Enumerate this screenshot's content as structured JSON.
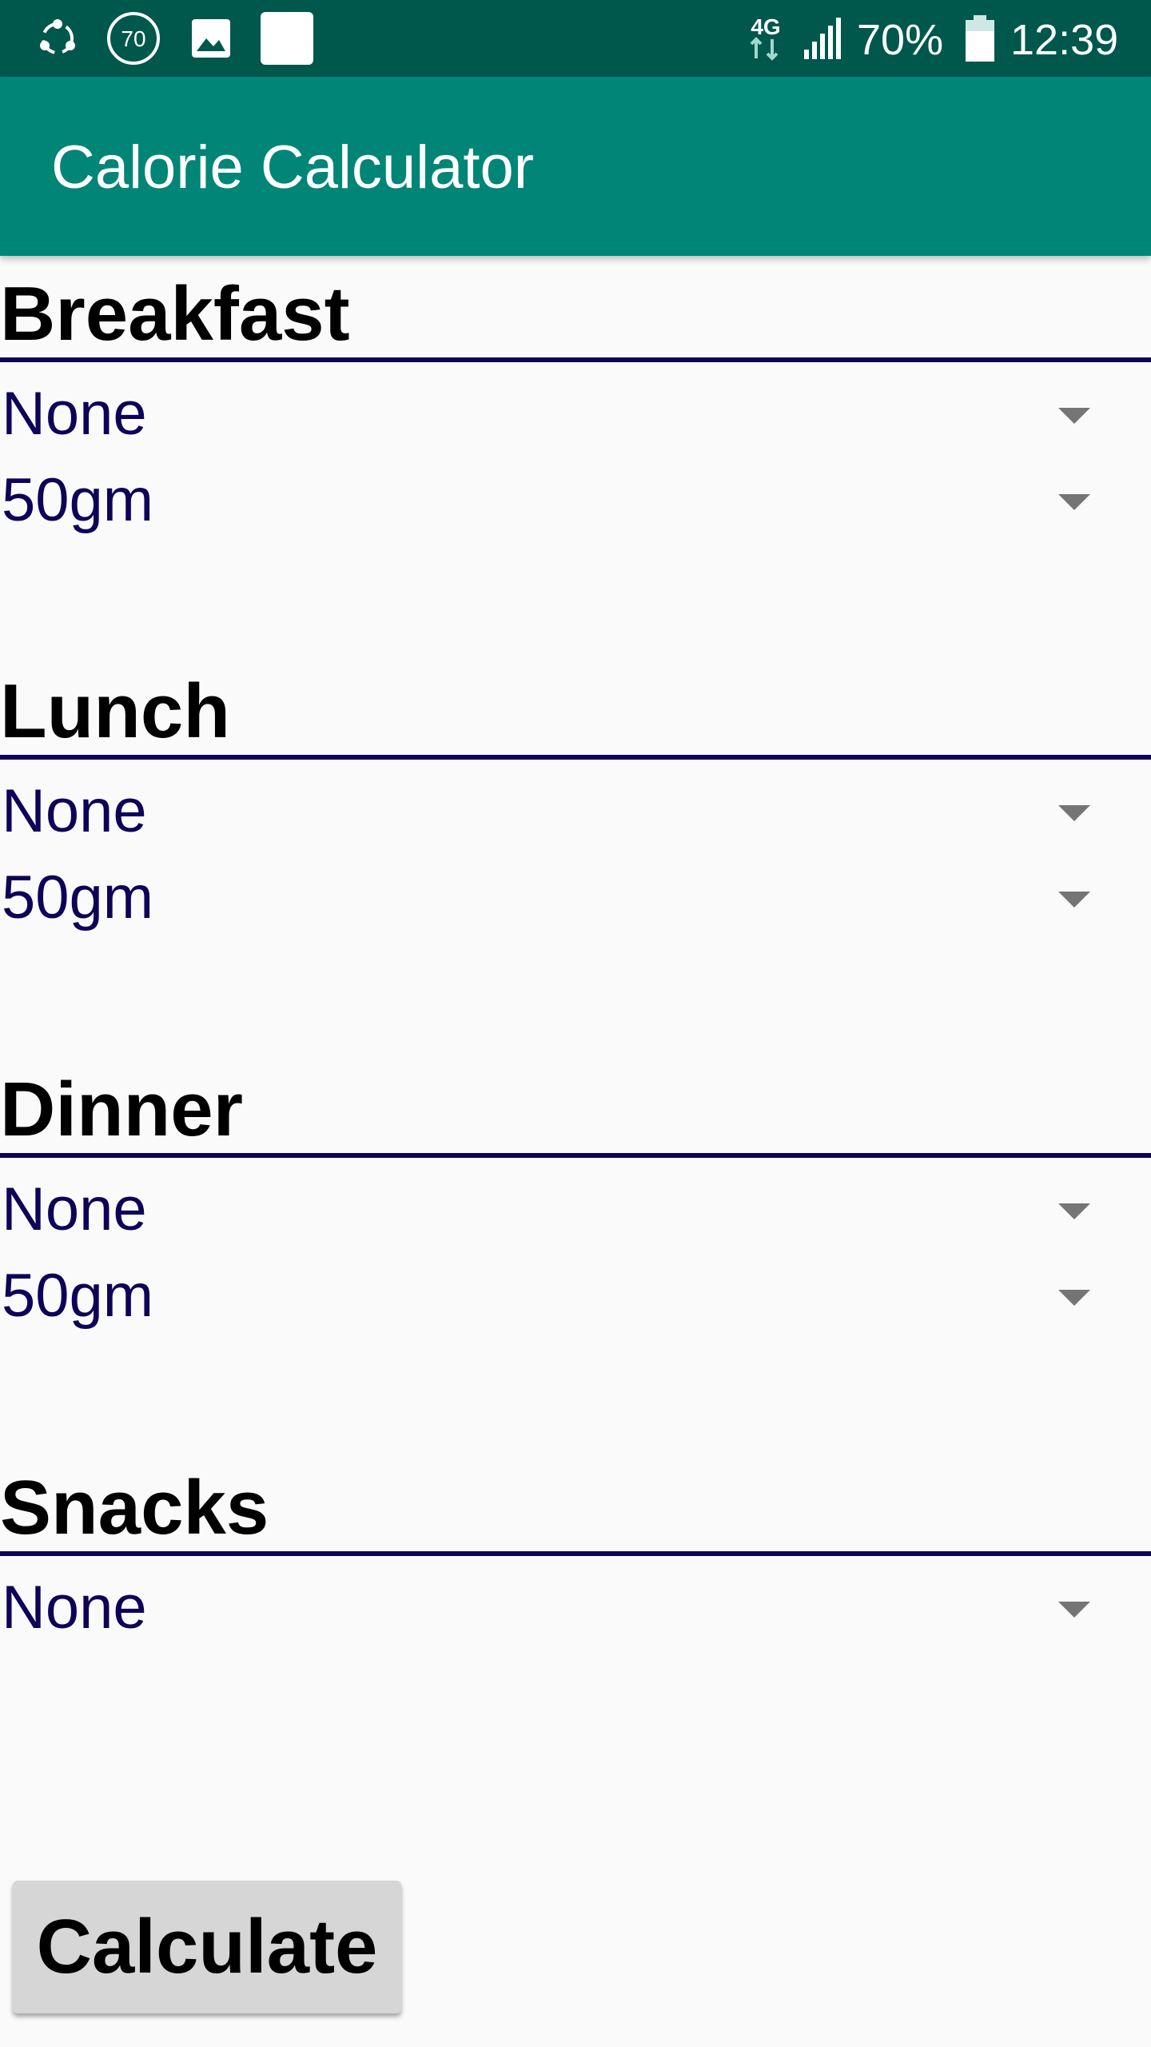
{
  "status_bar": {
    "icons": [
      "shareit-icon",
      "badge-70-icon",
      "image-icon",
      "blank-notification-icon",
      "network-4g-icon",
      "signal-icon",
      "battery-icon"
    ],
    "badge_text": "70",
    "network_type": "4G",
    "battery_percent": "70%",
    "time": "12:39"
  },
  "app_bar": {
    "title": "Calorie Calculator"
  },
  "sections": [
    {
      "heading": "Breakfast",
      "food": "None",
      "quantity": "50gm"
    },
    {
      "heading": "Lunch",
      "food": "None",
      "quantity": "50gm"
    },
    {
      "heading": "Dinner",
      "food": "None",
      "quantity": "50gm"
    },
    {
      "heading": "Snacks",
      "food": "None"
    }
  ],
  "calculate_label": "Calculate",
  "colors": {
    "status_bar": "#00574b",
    "app_bar": "#008577",
    "spinner_text": "#0d0358",
    "divider": "#0d0358",
    "background": "#fafafa",
    "button": "#d6d6d6"
  }
}
